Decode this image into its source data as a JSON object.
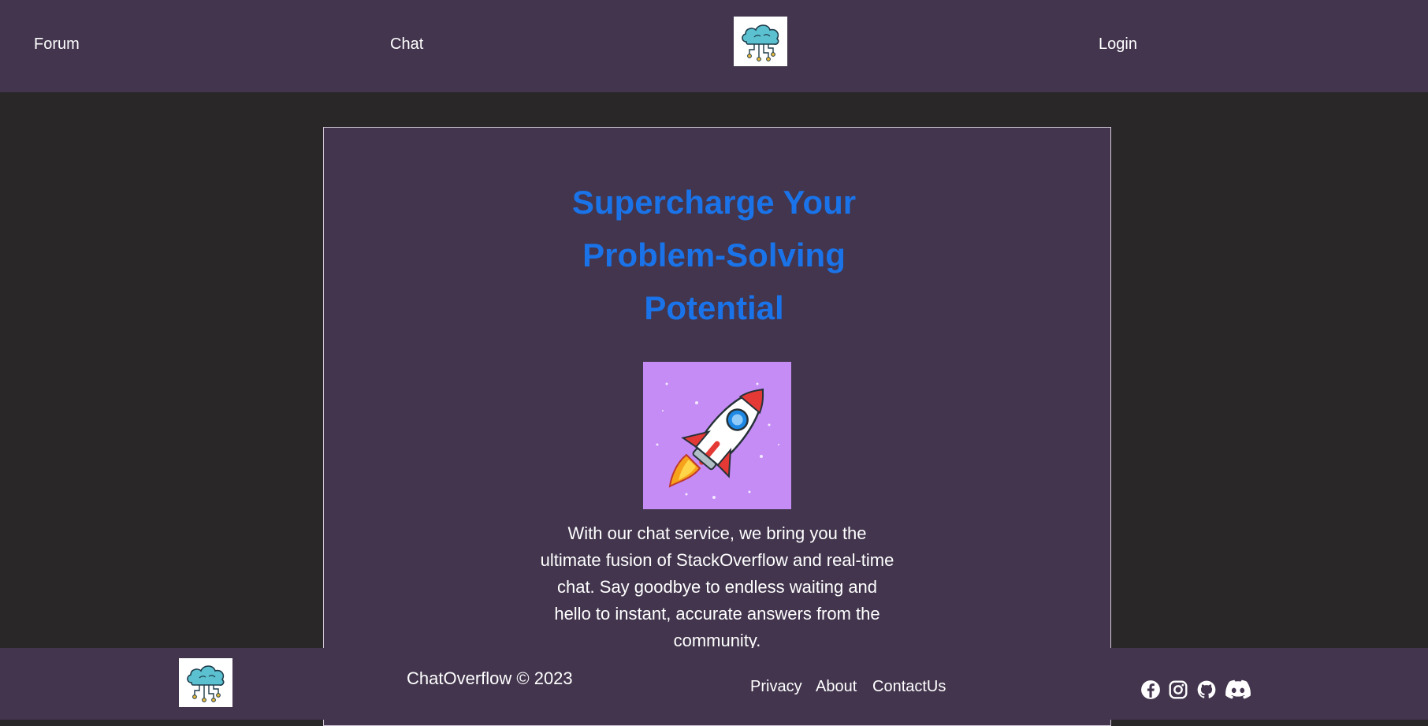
{
  "nav": {
    "forum_label": "Forum",
    "chat_label": "Chat",
    "login_label": "Login"
  },
  "hero": {
    "headline_line1": "Supercharge Your",
    "headline_line2": "Problem-Solving",
    "headline_line3": "Potential",
    "description": "With our chat service, we bring you the ultimate fusion of StackOverflow and real-time chat. Say goodbye to endless waiting and hello to instant, accurate answers from the community."
  },
  "footer": {
    "copyright": "ChatOverflow © 2023",
    "privacy_label": "Privacy",
    "about_label": "About",
    "contact_label": "ContactUs",
    "social_icons": [
      "facebook-icon",
      "instagram-icon",
      "github-icon",
      "discord-icon"
    ]
  },
  "colors": {
    "nav_bg": "#42354d",
    "page_bg": "#2a2729",
    "headline": "#1a73e8",
    "hero_image_bg": "#c58cf6"
  }
}
